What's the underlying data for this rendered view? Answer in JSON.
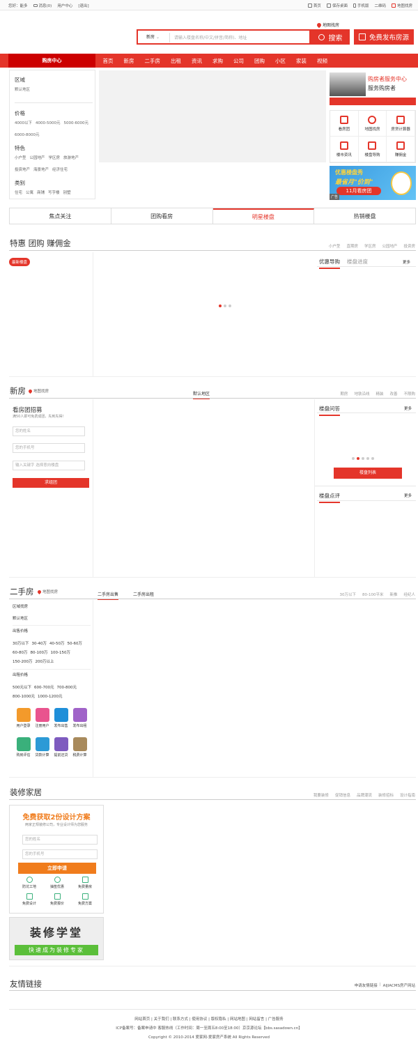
{
  "topbar": {
    "greeting": "您好：能多",
    "messages": "消息(0)",
    "user_center": "用户中心",
    "logout": "[退出]",
    "right": [
      "首页",
      "保存桌面",
      "手机版",
      "二维码",
      "地图找房"
    ]
  },
  "header": {
    "map_link": "地图找房",
    "search_type": "新房",
    "search_placeholder": "请输入楼盘名称/中文/拼音/简称)、地址",
    "search_button": "搜索",
    "publish_button": "免费发布房源"
  },
  "nav": {
    "home": "购房中心",
    "items": [
      "首页",
      "新房",
      "二手房",
      "出租",
      "资讯",
      "求购",
      "公司",
      "团购",
      "小区",
      "家装",
      "视频"
    ]
  },
  "filter": {
    "area_title": "区域",
    "area_items": [
      "默认地区"
    ],
    "price_title": "价格",
    "price_items": [
      "4000以下",
      "4000-5000元",
      "5000-6000元",
      "6000-8000元"
    ],
    "feature_title": "特色",
    "feature_items": [
      "小户型",
      "公园地产",
      "学区房",
      "旅游地产",
      "投资地产",
      "海景地产",
      "经济住宅"
    ],
    "type_title": "类别",
    "type_items": [
      "住宅",
      "公寓",
      "商铺",
      "写字楼",
      "别墅"
    ]
  },
  "service": {
    "title": "购房者服务中心",
    "subtitle": "服务购房者",
    "items": [
      "看房团",
      "地图找房",
      "房贷计算器",
      "楼市资讯",
      "楼盘导购",
      "赚佣金"
    ]
  },
  "ad": {
    "line1": "优惠楼盘秀",
    "line2": "最省月\"价到\"",
    "line3": "11月看房团",
    "tag": "广告"
  },
  "main_tabs": [
    "焦点关注",
    "团购看房",
    "明星楼盘",
    "热销楼盘"
  ],
  "special": {
    "title": "特惠 团购 赚佣金",
    "links": [
      "小户型",
      "直期房",
      "学区房",
      "公园地产",
      "投资房"
    ],
    "badge": "最新楼盘",
    "tab_on": "优惠导购",
    "tab_off": "楼盘进度",
    "more": "更多"
  },
  "newhouse": {
    "title": "新房",
    "map": "地图找房",
    "region_tab": "默认地区",
    "links": [
      "期房",
      "地铁沿线",
      "精装",
      "改善",
      "不限购"
    ],
    "group_title": "看房团招募",
    "group_desc": "满50人即可免费成团，先到先得！",
    "name_ph": "您的姓名",
    "phone_ph": "您的手机号",
    "keyword_ph": "输入关键字 选择意向楼盘",
    "join": "求组团",
    "qa_title": "楼盘问答",
    "qa_more": "更多",
    "list_btn": "楼盘列表",
    "review_title": "楼盘点评",
    "review_more": "更多"
  },
  "secondhand": {
    "title": "二手房",
    "map": "地图找房",
    "tab_sale": "二手房出售",
    "tab_rent": "二手房出租",
    "links": [
      "30万以下",
      "80-100平米",
      "新推",
      "经纪人"
    ],
    "area_title": "区域找房",
    "area_item": "默认地区",
    "sale_price_title": "出售价格",
    "sale_prices": [
      "30万以下",
      "30-40万",
      "40-50万",
      "50-60万",
      "60-80万",
      "80-100万",
      "100-150万",
      "150-200万",
      "200万以上"
    ],
    "rent_price_title": "出租价格",
    "rent_prices": [
      "500元以下",
      "600-700元",
      "700-800元",
      "800-1000元",
      "1000-1200元"
    ],
    "icons": [
      {
        "label": "用户登录",
        "color": "#f39a2b"
      },
      {
        "label": "注册用户",
        "color": "#e9548e"
      },
      {
        "label": "发布出售",
        "color": "#1f8fd9"
      },
      {
        "label": "发布出租",
        "color": "#a063c8"
      },
      {
        "label": "购房评估",
        "color": "#3ab07b"
      },
      {
        "label": "贷款计算",
        "color": "#2c9ad6"
      },
      {
        "label": "提前还贷",
        "color": "#7e5bbf"
      },
      {
        "label": "税费计算",
        "color": "#a88a5c"
      }
    ]
  },
  "decor": {
    "title": "装修家居",
    "links": [
      "我要装修",
      "促销信息",
      "品牌潮流",
      "装修招标",
      "设计指南"
    ],
    "free_title": "免费获取2份设计方案",
    "free_desc": "两家正规装修公司，专业设计师为您服务",
    "name_ph": "您的姓名",
    "phone_ph": "您的手机号",
    "apply": "立即申请",
    "features": [
      "防坑工地",
      "抽签优惠",
      "免费量房",
      "免费设计",
      "免费报价",
      "免费方案"
    ],
    "school_title": "装修学堂",
    "school_sub": "快速成为装修专家"
  },
  "friends": {
    "title": "友情链接",
    "apply": "申请友情链接",
    "site": "AIJIACMS房产网站"
  },
  "footer": {
    "links": "网站首页 | 关于我们 | 联系方式 | 使用协议 | 版权隐私 | 网站地图 | 网站留言 | 广告服务",
    "icp": "ICP备案号：备案申请中 客服热线（工作时间：周一至周五8:00至18:00）京京源论坛【bbs.sasadown.cn】",
    "copyright": "Copyright © 2010-2014 爱家网-爱家房产系统 All Rights Reserved"
  }
}
